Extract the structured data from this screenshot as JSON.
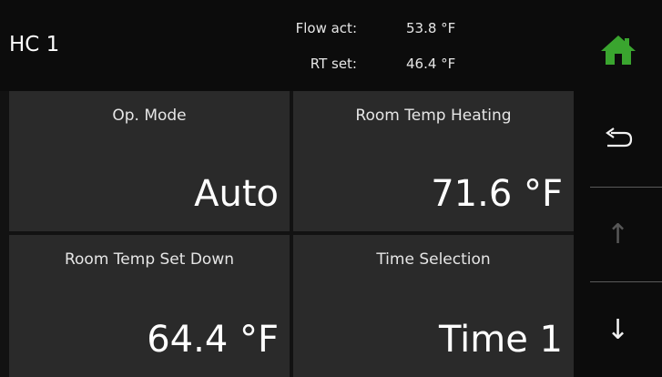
{
  "header": {
    "title": "HC 1",
    "flow_label": "Flow act:",
    "flow_value": "53.8 °F",
    "rt_label": "RT set:",
    "rt_value": "46.4 °F"
  },
  "tiles": [
    {
      "label": "Op. Mode",
      "value": "Auto"
    },
    {
      "label": "Room Temp Heating",
      "value": "71.6 °F"
    },
    {
      "label": "Room Temp Set Down",
      "value": "64.4 °F"
    },
    {
      "label": "Time Selection",
      "value": "Time 1"
    }
  ],
  "sidebar": {
    "home_icon": "home-icon",
    "back_icon": "back-arrow-icon",
    "up_icon": "arrow-up-icon",
    "up_enabled": false,
    "down_icon": "arrow-down-icon",
    "down_enabled": true,
    "home_color": "#3aa52f"
  },
  "colors": {
    "background": "#121212",
    "tile": "#2a2a2a",
    "text": "#ffffff"
  }
}
